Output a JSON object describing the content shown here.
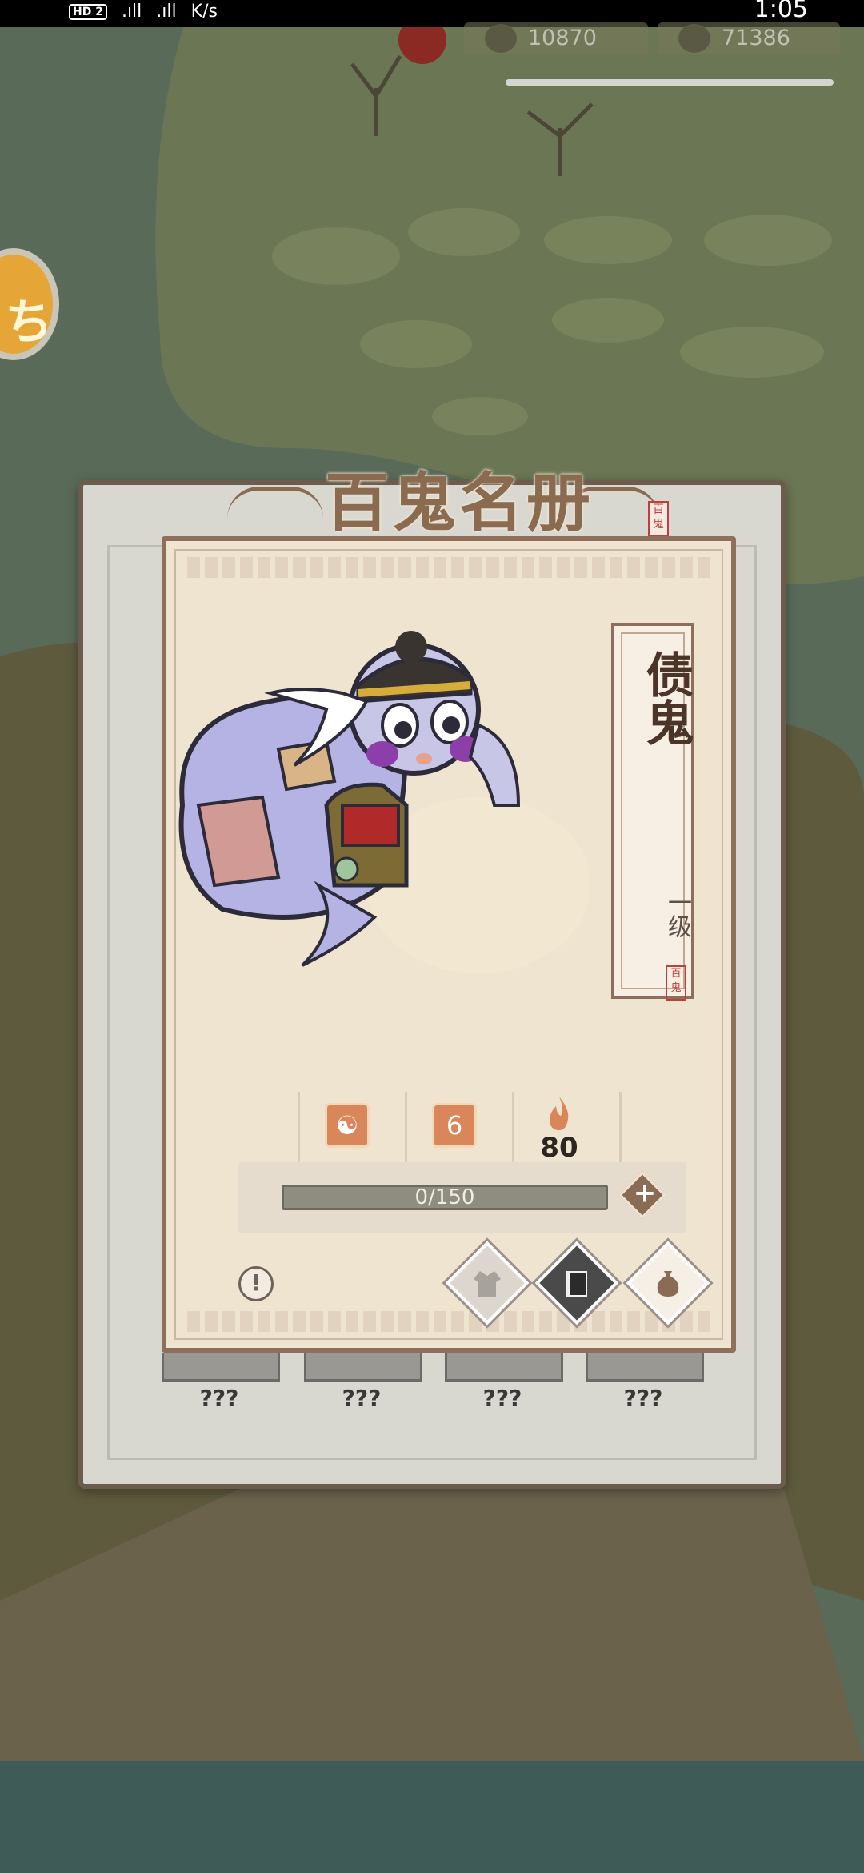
{
  "statusbar": {
    "hd_badge": "HD 2",
    "signal_1": ".ıll",
    "signal_2": ".ıll",
    "net_speed": "K/s",
    "clock": "1:05"
  },
  "resources": [
    {
      "icon": "temple-icon",
      "value": "10870"
    },
    {
      "icon": "stone-icon",
      "value": "71386"
    }
  ],
  "dialog": {
    "title": "百鬼名册",
    "title_seal": "百鬼"
  },
  "card": {
    "monster_name": "债鬼",
    "monster_level": "一级",
    "name_seal": "百鬼",
    "stats": {
      "type_icon": "yin-yang-icon",
      "rank_badge": "6",
      "power_value": "80"
    },
    "exp": {
      "text": "0/150",
      "current": 0,
      "max": 150
    },
    "actions": [
      {
        "name": "robe-icon"
      },
      {
        "name": "book-icon"
      },
      {
        "name": "money-bag-icon"
      }
    ]
  },
  "slots": [
    {
      "label": "???"
    },
    {
      "label": "???"
    },
    {
      "label": "???"
    },
    {
      "label": "???"
    }
  ],
  "colors": {
    "card_bg": "#efe4d0",
    "frame_brown": "#8e6f5b",
    "seal_red": "#c23d3d",
    "stat_orange": "#d9875a"
  }
}
